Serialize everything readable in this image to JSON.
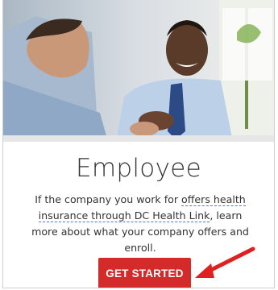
{
  "card": {
    "title": "Employee",
    "description_before": "If the company you work for ",
    "link_text": "offers health insurance through DC Health Link",
    "description_after": ", learn more about what your company offers and enroll.",
    "cta_label": "GET STARTED"
  },
  "colors": {
    "cta_background": "#d42a2a",
    "link_underline": "#3b7fd1",
    "arrow": "#e02020",
    "text": "#333333"
  },
  "icons": {
    "annotation": "red-arrow-icon"
  }
}
